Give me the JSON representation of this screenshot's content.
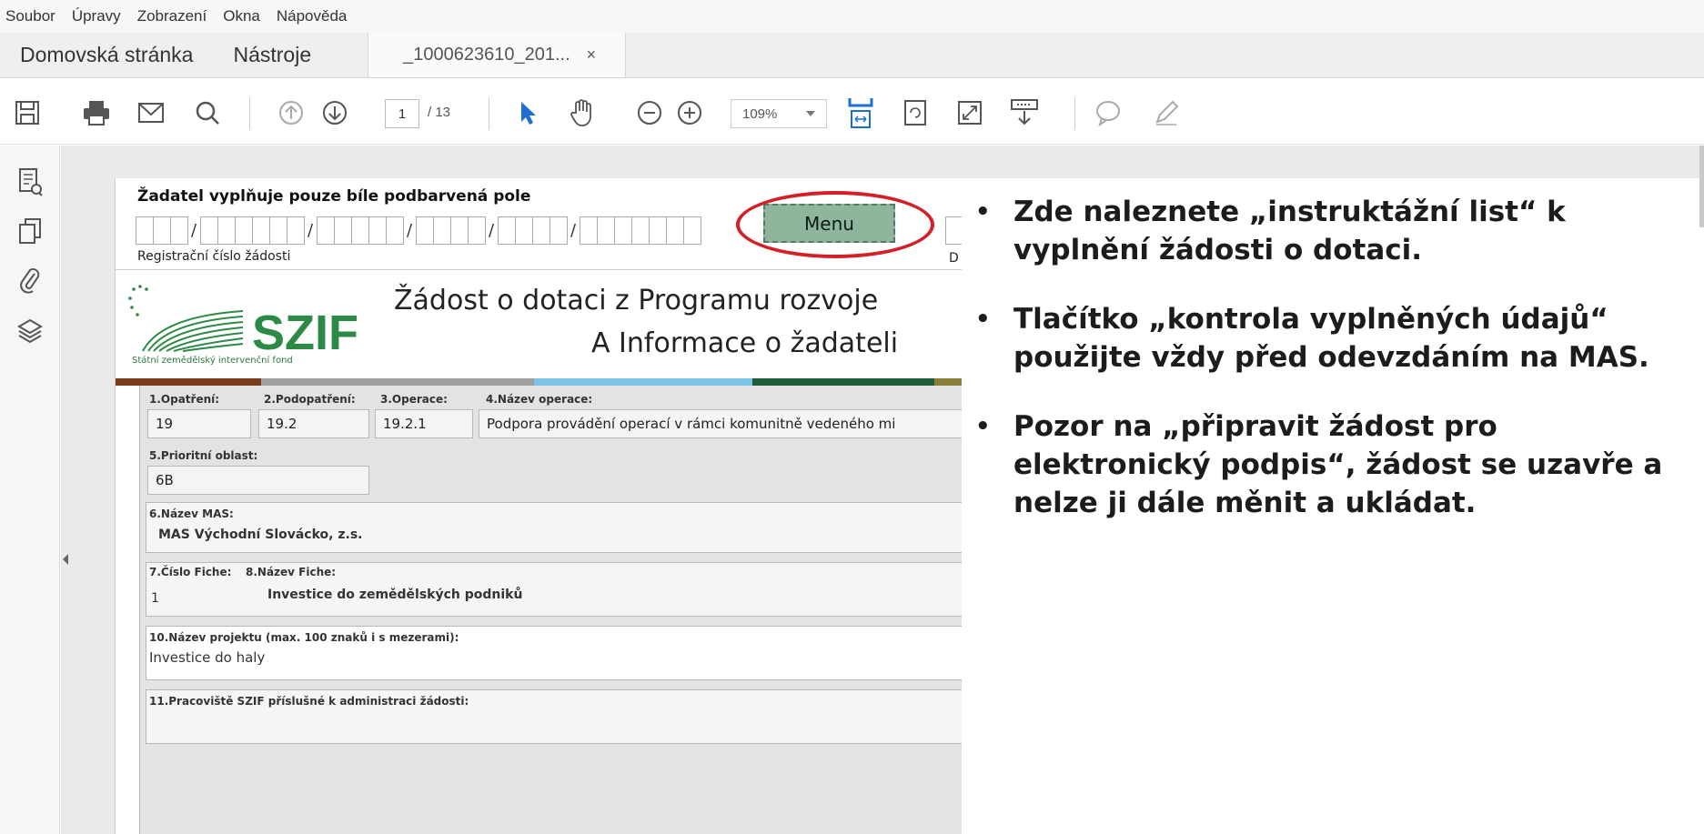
{
  "menubar": [
    "Soubor",
    "Úpravy",
    "Zobrazení",
    "Okna",
    "Nápověda"
  ],
  "tabs": {
    "home": "Domovská stránka",
    "tools": "Nástroje",
    "document": "_1000623610_201...",
    "close": "×"
  },
  "toolbar": {
    "page_current": "1",
    "page_total": "/ 13",
    "zoom": "109%",
    "icons": [
      "save-icon",
      "print-icon",
      "email-icon",
      "search-icon",
      "page-up-icon",
      "page-down-icon",
      "select-arrow-icon",
      "hand-icon",
      "zoom-out-icon",
      "zoom-in-icon",
      "fit-width-icon",
      "rotate-icon",
      "fullscreen-icon",
      "read-mode-icon",
      "comment-icon",
      "pen-icon"
    ]
  },
  "leftpanel": {
    "icons": [
      "page-thumbnails-icon",
      "copy-pages-icon",
      "attachment-icon",
      "layers-icon"
    ]
  },
  "form": {
    "fill_note": "Žadatel vyplňuje pouze bíle podbarvená pole",
    "reg_label": "Registrační číslo žádosti",
    "menu_button": "Menu",
    "d_label": "D",
    "logo_text": "SZIF",
    "logo_sub": "Státní zemědělský intervenční fond",
    "title": "Žádost o dotaci z Programu rozvoje",
    "subtitle": "A Informace o žadateli",
    "f1_label": "1.Opatření:",
    "f1_value": "19",
    "f2_label": "2.Podopatření:",
    "f2_value": "19.2",
    "f3_label": "3.Operace:",
    "f3_value": "19.2.1",
    "f4_label": "4.Název operace:",
    "f4_value": "Podpora provádění operací v rámci komunitně vedeného mi",
    "f5_label": "5.Prioritní oblast:",
    "f5_value": "6B",
    "f6_label": "6.Název MAS:",
    "f6_value": "MAS Východní Slovácko, z.s.",
    "f7_label": "7.Číslo Fiche:",
    "f7_value": "1",
    "f8_label": "8.Název Fiche:",
    "f8_value": "Investice do zemědělských podniků",
    "f10_label": "10.Název projektu (max. 100 znaků i s mezerami):",
    "f10_value": "Investice do haly",
    "f11_label": "11.Pracoviště SZIF příslušné k administraci žádosti:"
  },
  "colors": {
    "menu_button": "#8fb59c",
    "highlight_ellipse": "#d41f27",
    "colorbar": [
      "#7a3b1d",
      "#a0a0a0",
      "#7cc3e8",
      "#1f5e3c",
      "#8a7f3a"
    ]
  },
  "notes": [
    "Zde naleznete „instruktážní list“ k vyplnění žádosti o dotaci.",
    "Tlačítko „kontrola vyplněných údajů“ použijte vždy před odevzdáním na MAS.",
    "Pozor na „připravit žádost pro elektronický podpis“, žádost se uzavře a nelze ji dále měnit a ukládat."
  ]
}
